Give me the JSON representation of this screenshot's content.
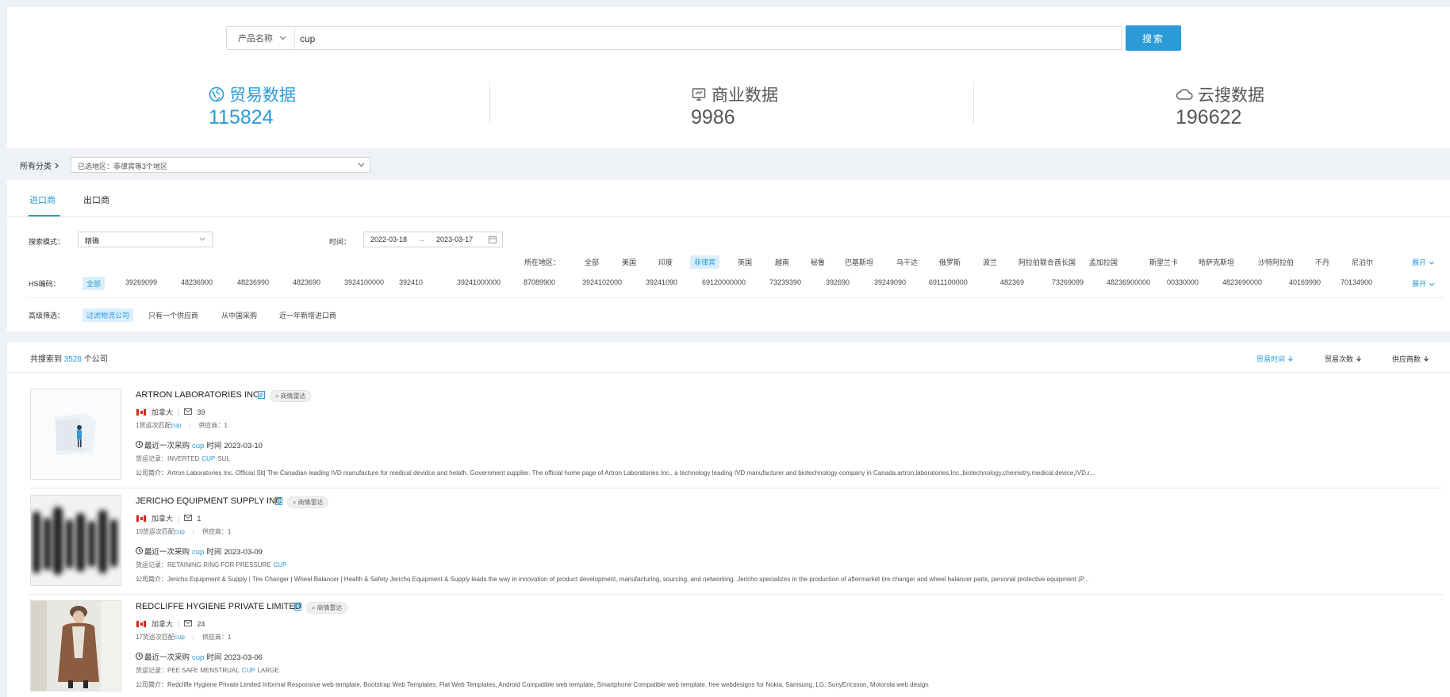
{
  "search": {
    "type_label": "产品名称",
    "query": "cup",
    "button_label": "搜索"
  },
  "stats": [
    {
      "label": "贸易数据",
      "value": "115824",
      "icon": "globe-icon",
      "active": true
    },
    {
      "label": "商业数据",
      "value": "9986",
      "icon": "chart-board-icon",
      "active": false
    },
    {
      "label": "云搜数据",
      "value": "196622",
      "icon": "cloud-icon",
      "active": false
    }
  ],
  "category": {
    "label": "所有分类",
    "region_value": "已选地区：菲律宾等3个地区"
  },
  "tabs": [
    "进口商",
    "出口商"
  ],
  "filters": {
    "search_mode_label": "搜索模式：",
    "search_mode_value": "精确",
    "time_label": "时间：",
    "date_start": "2022-03-18",
    "date_arrow": "→",
    "date_end": "2023-03-17",
    "region_label": "所在地区：",
    "regions": [
      "全部",
      "美国",
      "印度",
      "菲律宾",
      "英国",
      "越南",
      "秘鲁",
      "巴基斯坦",
      "乌干达",
      "俄罗斯",
      "波兰",
      "阿拉伯联合酋长国",
      "孟加拉国",
      "斯里兰卡",
      "哈萨克斯坦",
      "沙特阿拉伯",
      "不丹",
      "尼泊尔"
    ],
    "hs_label": "HS编码：",
    "hs_codes": [
      "全部",
      "39269099",
      "48236900",
      "48236990",
      "4823690",
      "3924100000",
      "392410",
      "39241000000",
      "87089900",
      "3924102000",
      "39241090",
      "69120000000",
      "73239390",
      "392690",
      "39249090",
      "6911100000",
      "482369",
      "73269099",
      "48236900000",
      "00330000",
      "4823690000",
      "40169990",
      "70134900"
    ],
    "expand_label": "展开",
    "advanced_label": "高级筛选：",
    "advanced": [
      "过滤物流公司",
      "只有一个供应商",
      "从中国采购",
      "近一年新增进口商"
    ]
  },
  "results": {
    "prefix": "共搜索到",
    "count": "3528",
    "suffix": "个公司",
    "sorts": [
      "贸易时间",
      "贸易次数",
      "供应商数"
    ],
    "items": [
      {
        "name": "ARTRON LABORATORIES INC.",
        "tag": "商情雷达",
        "country": "加拿大",
        "mail_count": "39",
        "match_prefix": "1货运次匹配",
        "match_term": "cup",
        "supplier_label": "供应商：",
        "supplier_count": "1",
        "recent_label": "最近一次采购",
        "recent_term": "cup",
        "recent_time_label": "时间",
        "recent_date": "2023-03-10",
        "goods_label": "货运记录：",
        "goods_pre": "INVERTED",
        "goods_hl": "CUP",
        "goods_post": "SUL",
        "desc_label": "公司简介：",
        "desc": "Artron Laboratories Inc. Official Sit| The Canadian leading IVD manufacture for medical devidce and helath. Government supplier. The official home page of Artron Laboratories Inc., a technology leading IVD manufacturer and biotechnology company in Canada.artron,laboratories,Inc.,biotechnology,chemistry,medical,device,IVD,r..."
      },
      {
        "name": "JERICHO EQUIPMENT SUPPLY INC",
        "tag": "商情雷达",
        "country": "加拿大",
        "mail_count": "1",
        "match_prefix": "10货运次匹配",
        "match_term": "cup",
        "supplier_label": "供应商：",
        "supplier_count": "1",
        "recent_label": "最近一次采购",
        "recent_term": "cup",
        "recent_time_label": "时间",
        "recent_date": "2023-03-09",
        "goods_label": "货运记录：",
        "goods_pre": "RETAINING RING FOR PRESSURE",
        "goods_hl": "CUP",
        "goods_post": "",
        "desc_label": "公司简介：",
        "desc": "Jericho Equipment & Supply | Tire Changer | Wheel Balancer | Health & Safety Jericho Equipment & Supply leads the way in innovation of product development, manufacturing, sourcing, and networking. Jericho specializes in the production of aftermarket tire changer and wheel balancer parts, personal protective equipment (P..."
      },
      {
        "name": "REDCLIFFE HYGIENE PRIVATE LIMITED",
        "tag": "商情雷达",
        "country": "加拿大",
        "mail_count": "24",
        "match_prefix": "17货运次匹配",
        "match_term": "cup",
        "supplier_label": "供应商：",
        "supplier_count": "1",
        "recent_label": "最近一次采购",
        "recent_term": "cup",
        "recent_time_label": "时间",
        "recent_date": "2023-03-06",
        "goods_label": "货运记录：",
        "goods_pre": "PEE SAFE MENSTRUAL",
        "goods_hl": "CUP",
        "goods_post": "LARGE",
        "desc_label": "公司简介：",
        "desc": "Redcliffe Hygiene Private Limited Informal Responsive web template, Bootstrap Web Templates, Flat Web Templates, Android Compatible web template, Smartphone Compatible web template, free webdesigns for Nokia, Samsung, LG, SonyEricsson, Motorola web design"
      }
    ]
  },
  "colors": {
    "accent": "#2b9bd8",
    "page_bg": "#eef1f5"
  }
}
